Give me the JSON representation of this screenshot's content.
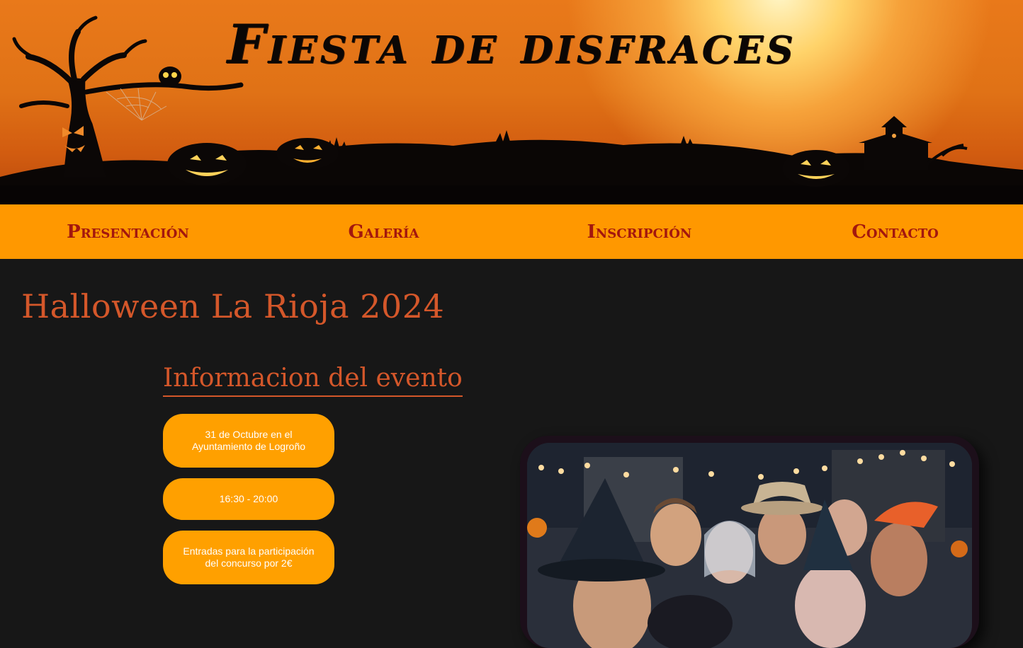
{
  "banner": {
    "title": "Fiesta de disfraces"
  },
  "nav": {
    "items": [
      {
        "label": "Presentación"
      },
      {
        "label": "Galería"
      },
      {
        "label": "Inscripción"
      },
      {
        "label": "Contacto"
      }
    ]
  },
  "main": {
    "title": "Halloween La Rioja 2024",
    "section_title": "Informacion del evento",
    "info": [
      {
        "text": "31 de Octubre en el Ayuntamiento de Logroño"
      },
      {
        "text": "16:30 - 20:00"
      },
      {
        "text": "Entradas para la participación del concurso por 2€"
      }
    ]
  },
  "colors": {
    "nav_bg": "#ff9800",
    "nav_text": "#a3170e",
    "heading": "#d4572a",
    "pill_bg": "#ffa000",
    "page_bg": "#171717"
  }
}
